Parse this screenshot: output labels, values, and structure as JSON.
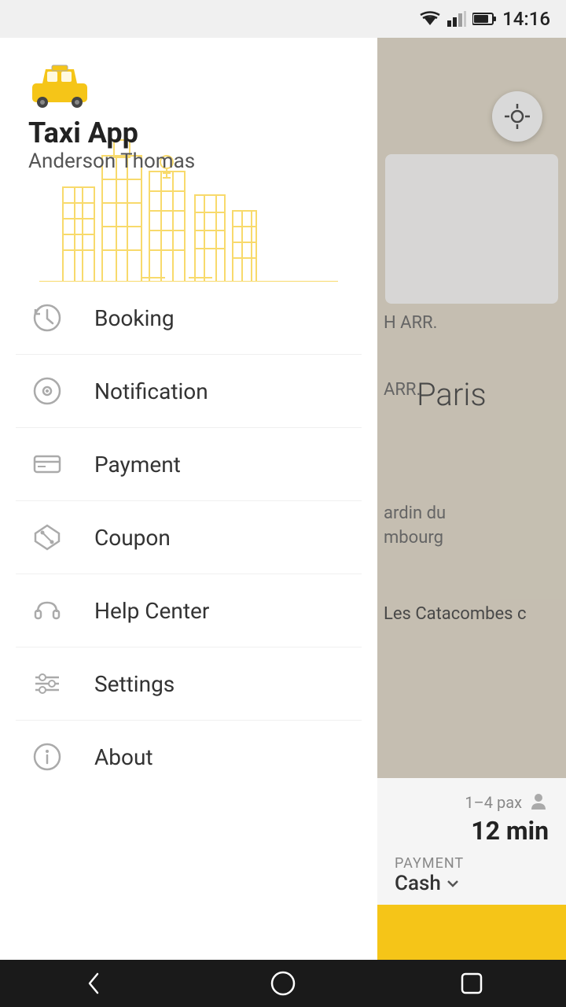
{
  "statusBar": {
    "time": "14:16"
  },
  "sidebar": {
    "appTitle": "Taxi App",
    "userName": "Anderson Thomas",
    "menuItems": [
      {
        "id": "booking",
        "label": "Booking",
        "icon": "history"
      },
      {
        "id": "notification",
        "label": "Notification",
        "icon": "notification"
      },
      {
        "id": "payment",
        "label": "Payment",
        "icon": "payment"
      },
      {
        "id": "coupon",
        "label": "Coupon",
        "icon": "coupon"
      },
      {
        "id": "helpcenter",
        "label": "Help Center",
        "icon": "headphone"
      },
      {
        "id": "settings",
        "label": "Settings",
        "icon": "settings"
      },
      {
        "id": "about",
        "label": "About",
        "icon": "info"
      }
    ]
  },
  "map": {
    "parisLabel": "Paris",
    "paxInfo": "1–4 pax",
    "etaLabel": "12 min",
    "paymentLabel": "PAYMENT",
    "paymentMethod": "Cash"
  },
  "nav": {
    "back": "◁",
    "home": "○",
    "recents": "□"
  },
  "colors": {
    "yellow": "#f5c518",
    "iconGray": "#aaa"
  }
}
